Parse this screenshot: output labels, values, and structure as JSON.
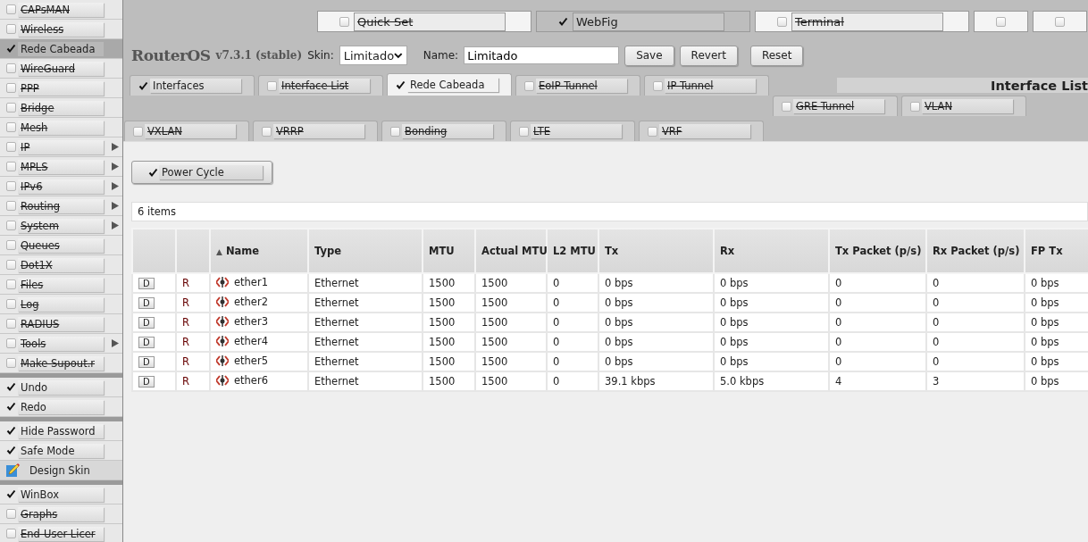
{
  "sidebar": {
    "groups": [
      {
        "items": [
          {
            "label": "CAPsMAN",
            "checked": false,
            "selected": false,
            "submenu": false,
            "kind": "check"
          },
          {
            "label": "Wireless",
            "checked": false,
            "selected": false,
            "submenu": false,
            "kind": "check"
          },
          {
            "label": "Rede Cabeada",
            "checked": true,
            "selected": true,
            "submenu": false,
            "kind": "check"
          },
          {
            "label": "WireGuard",
            "checked": false,
            "selected": false,
            "submenu": false,
            "kind": "check"
          },
          {
            "label": "PPP",
            "checked": false,
            "selected": false,
            "submenu": false,
            "kind": "check"
          },
          {
            "label": "Bridge",
            "checked": false,
            "selected": false,
            "submenu": false,
            "kind": "check"
          },
          {
            "label": "Mesh",
            "checked": false,
            "selected": false,
            "submenu": false,
            "kind": "check"
          },
          {
            "label": "IP",
            "checked": false,
            "selected": false,
            "submenu": true,
            "kind": "check"
          },
          {
            "label": "MPLS",
            "checked": false,
            "selected": false,
            "submenu": true,
            "kind": "check"
          },
          {
            "label": "IPv6",
            "checked": false,
            "selected": false,
            "submenu": true,
            "kind": "check"
          },
          {
            "label": "Routing",
            "checked": false,
            "selected": false,
            "submenu": true,
            "kind": "check"
          },
          {
            "label": "System",
            "checked": false,
            "selected": false,
            "submenu": true,
            "kind": "check"
          },
          {
            "label": "Queues",
            "checked": false,
            "selected": false,
            "submenu": false,
            "kind": "check"
          },
          {
            "label": "Dot1X",
            "checked": false,
            "selected": false,
            "submenu": false,
            "kind": "check"
          },
          {
            "label": "Files",
            "checked": false,
            "selected": false,
            "submenu": false,
            "kind": "check"
          },
          {
            "label": "Log",
            "checked": false,
            "selected": false,
            "submenu": false,
            "kind": "check"
          },
          {
            "label": "RADIUS",
            "checked": false,
            "selected": false,
            "submenu": false,
            "kind": "check"
          },
          {
            "label": "Tools",
            "checked": false,
            "selected": false,
            "submenu": true,
            "kind": "check"
          },
          {
            "label": "Make Supout.r",
            "checked": false,
            "selected": false,
            "submenu": false,
            "kind": "check"
          }
        ]
      },
      {
        "items": [
          {
            "label": "Undo",
            "checked": true,
            "selected": false,
            "submenu": false,
            "kind": "check"
          },
          {
            "label": "Redo",
            "checked": true,
            "selected": false,
            "submenu": false,
            "kind": "check"
          }
        ]
      },
      {
        "items": [
          {
            "label": "Hide Password",
            "checked": true,
            "selected": false,
            "submenu": false,
            "kind": "check"
          },
          {
            "label": "Safe Mode",
            "checked": true,
            "selected": false,
            "submenu": false,
            "kind": "check"
          },
          {
            "label": "Design Skin",
            "selected": false,
            "kind": "icon"
          }
        ]
      },
      {
        "items": [
          {
            "label": "WinBox",
            "checked": true,
            "selected": false,
            "submenu": false,
            "kind": "check"
          },
          {
            "label": "Graphs",
            "checked": false,
            "selected": false,
            "submenu": false,
            "kind": "check"
          },
          {
            "label": "End-User Licer",
            "checked": false,
            "selected": false,
            "submenu": false,
            "kind": "check"
          }
        ]
      }
    ]
  },
  "mode_tabs": [
    {
      "label": "Quick Set",
      "checked": false,
      "selected": false
    },
    {
      "label": "WebFig",
      "checked": true,
      "selected": true
    },
    {
      "label": "Terminal",
      "checked": false,
      "selected": false
    },
    {
      "checked": false,
      "selected": false
    },
    {
      "checked": false,
      "selected": false
    }
  ],
  "header": {
    "product": "RouterOS",
    "version": "v7.3.1 (stable)",
    "skin_label": "Skin:",
    "skin_value": "Limitado",
    "name_label": "Name:",
    "name_value": "Limitado",
    "buttons": [
      "Save",
      "Revert",
      "Reset"
    ]
  },
  "tab_rows": [
    [
      {
        "label": "Interfaces",
        "checked": true,
        "selected": false
      },
      {
        "label": "Interface List",
        "checked": false,
        "selected": false
      },
      {
        "label": "Rede Cabeada",
        "checked": true,
        "selected": true
      },
      {
        "label": "EoIP Tunnel",
        "checked": false,
        "selected": false
      },
      {
        "label": "IP Tunnel",
        "checked": false,
        "selected": false
      }
    ],
    [
      {
        "label": "GRE Tunnel",
        "checked": false,
        "selected": false
      },
      {
        "label": "VLAN",
        "checked": false,
        "selected": false
      }
    ],
    [
      {
        "label": "VXLAN",
        "checked": false,
        "selected": false
      },
      {
        "label": "VRRP",
        "checked": false,
        "selected": false
      },
      {
        "label": "Bonding",
        "checked": false,
        "selected": false
      },
      {
        "label": "LTE",
        "checked": false,
        "selected": false
      },
      {
        "label": "VRF",
        "checked": false,
        "selected": false
      }
    ]
  ],
  "page_title": "Interface List",
  "action_button": {
    "label": "Power Cycle",
    "checked": true
  },
  "item_count": "6 items",
  "table": {
    "columns": [
      {},
      {},
      {
        "label": "Name",
        "sort": "▲"
      },
      {
        "label": "Type"
      },
      {
        "label": "MTU"
      },
      {
        "label": "Actual MTU"
      },
      {
        "label": "L2 MTU"
      },
      {
        "label": "Tx"
      },
      {
        "label": "Rx"
      },
      {
        "label": "Tx Packet (p/s)"
      },
      {
        "label": "Rx Packet (p/s)"
      },
      {
        "label": "FP Tx"
      }
    ],
    "rows": [
      {
        "button": "D",
        "flags": "R",
        "name": "ether1",
        "type": "Ethernet",
        "mtu": "1500",
        "actual_mtu": "1500",
        "l2_mtu": "0",
        "tx": "0 bps",
        "rx": "0 bps",
        "tx_packet": "0",
        "rx_packet": "0",
        "fp_tx": "0 bps"
      },
      {
        "button": "D",
        "flags": "R",
        "name": "ether2",
        "type": "Ethernet",
        "mtu": "1500",
        "actual_mtu": "1500",
        "l2_mtu": "0",
        "tx": "0 bps",
        "rx": "0 bps",
        "tx_packet": "0",
        "rx_packet": "0",
        "fp_tx": "0 bps"
      },
      {
        "button": "D",
        "flags": "R",
        "name": "ether3",
        "type": "Ethernet",
        "mtu": "1500",
        "actual_mtu": "1500",
        "l2_mtu": "0",
        "tx": "0 bps",
        "rx": "0 bps",
        "tx_packet": "0",
        "rx_packet": "0",
        "fp_tx": "0 bps"
      },
      {
        "button": "D",
        "flags": "R",
        "name": "ether4",
        "type": "Ethernet",
        "mtu": "1500",
        "actual_mtu": "1500",
        "l2_mtu": "0",
        "tx": "0 bps",
        "rx": "0 bps",
        "tx_packet": "0",
        "rx_packet": "0",
        "fp_tx": "0 bps"
      },
      {
        "button": "D",
        "flags": "R",
        "name": "ether5",
        "type": "Ethernet",
        "mtu": "1500",
        "actual_mtu": "1500",
        "l2_mtu": "0",
        "tx": "0 bps",
        "rx": "0 bps",
        "tx_packet": "0",
        "rx_packet": "0",
        "fp_tx": "0 bps"
      },
      {
        "button": "D",
        "flags": "R",
        "name": "ether6",
        "type": "Ethernet",
        "mtu": "1500",
        "actual_mtu": "1500",
        "l2_mtu": "0",
        "tx": "39.1 kbps",
        "rx": "5.0 kbps",
        "tx_packet": "4",
        "rx_packet": "3",
        "fp_tx": "0 bps"
      }
    ]
  }
}
